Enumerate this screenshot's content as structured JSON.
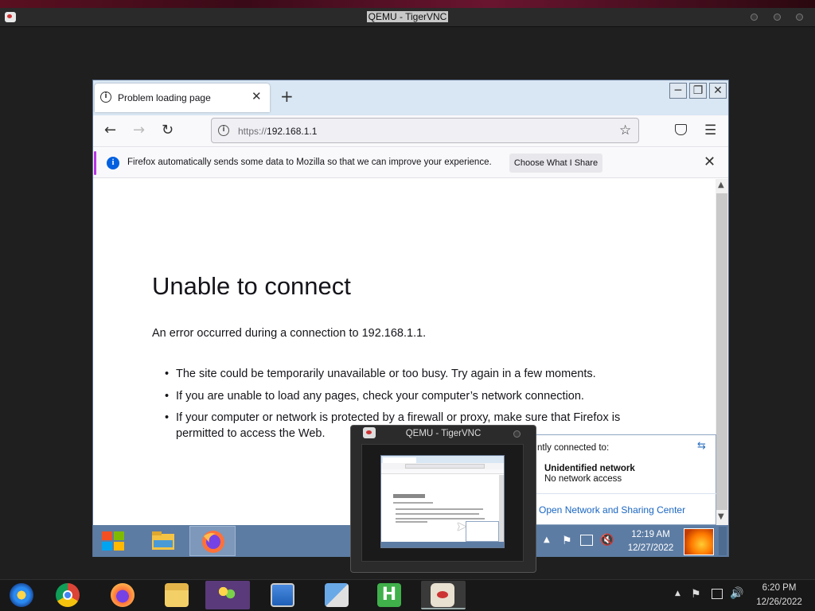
{
  "host_window": {
    "title": "QEMU - TigerVNC"
  },
  "browser": {
    "tab_title": "Problem loading page",
    "tab_close": "✕",
    "new_tab": "+",
    "url_protocol": "https://",
    "url_host": "192.168.1.1",
    "notification": {
      "text": "Firefox automatically sends some data to Mozilla so that we can improve your experience.",
      "button": "Choose What I Share",
      "close": "✕"
    },
    "error": {
      "title": "Unable to connect",
      "description": "An error occurred during a connection to 192.168.1.1.",
      "bullets": [
        "The site could be temporarily unavailable or too busy. Try again in a few moments.",
        "If you are unable to load any pages, check your computer’s network connection.",
        "If your computer or network is protected by a firewall or proxy, make sure that Firefox is permitted to access the Web."
      ]
    }
  },
  "network_flyout": {
    "connected_to": "ntly connected to:",
    "network_name": "Unidentified network",
    "network_status": "No network access",
    "sharing_link": "Open Network and Sharing Center"
  },
  "thumbnail": {
    "title": "QEMU - TigerVNC"
  },
  "guest_taskbar": {
    "time": "12:19 AM",
    "date": "12/27/2022"
  },
  "host_taskbar": {
    "time": "6:20 PM",
    "date": "12/26/2022"
  },
  "icons": {
    "back": "arrow-left-icon",
    "forward": "arrow-right-icon",
    "reload": "reload-icon",
    "star": "bookmark-star-icon",
    "pocket": "pocket-icon",
    "menu": "hamburger-menu-icon"
  },
  "colors": {
    "notification_accent": "#b833e1",
    "info_blue": "#0060df",
    "guest_taskbar": "#5d7ca3",
    "link_blue": "#1a66c2"
  }
}
